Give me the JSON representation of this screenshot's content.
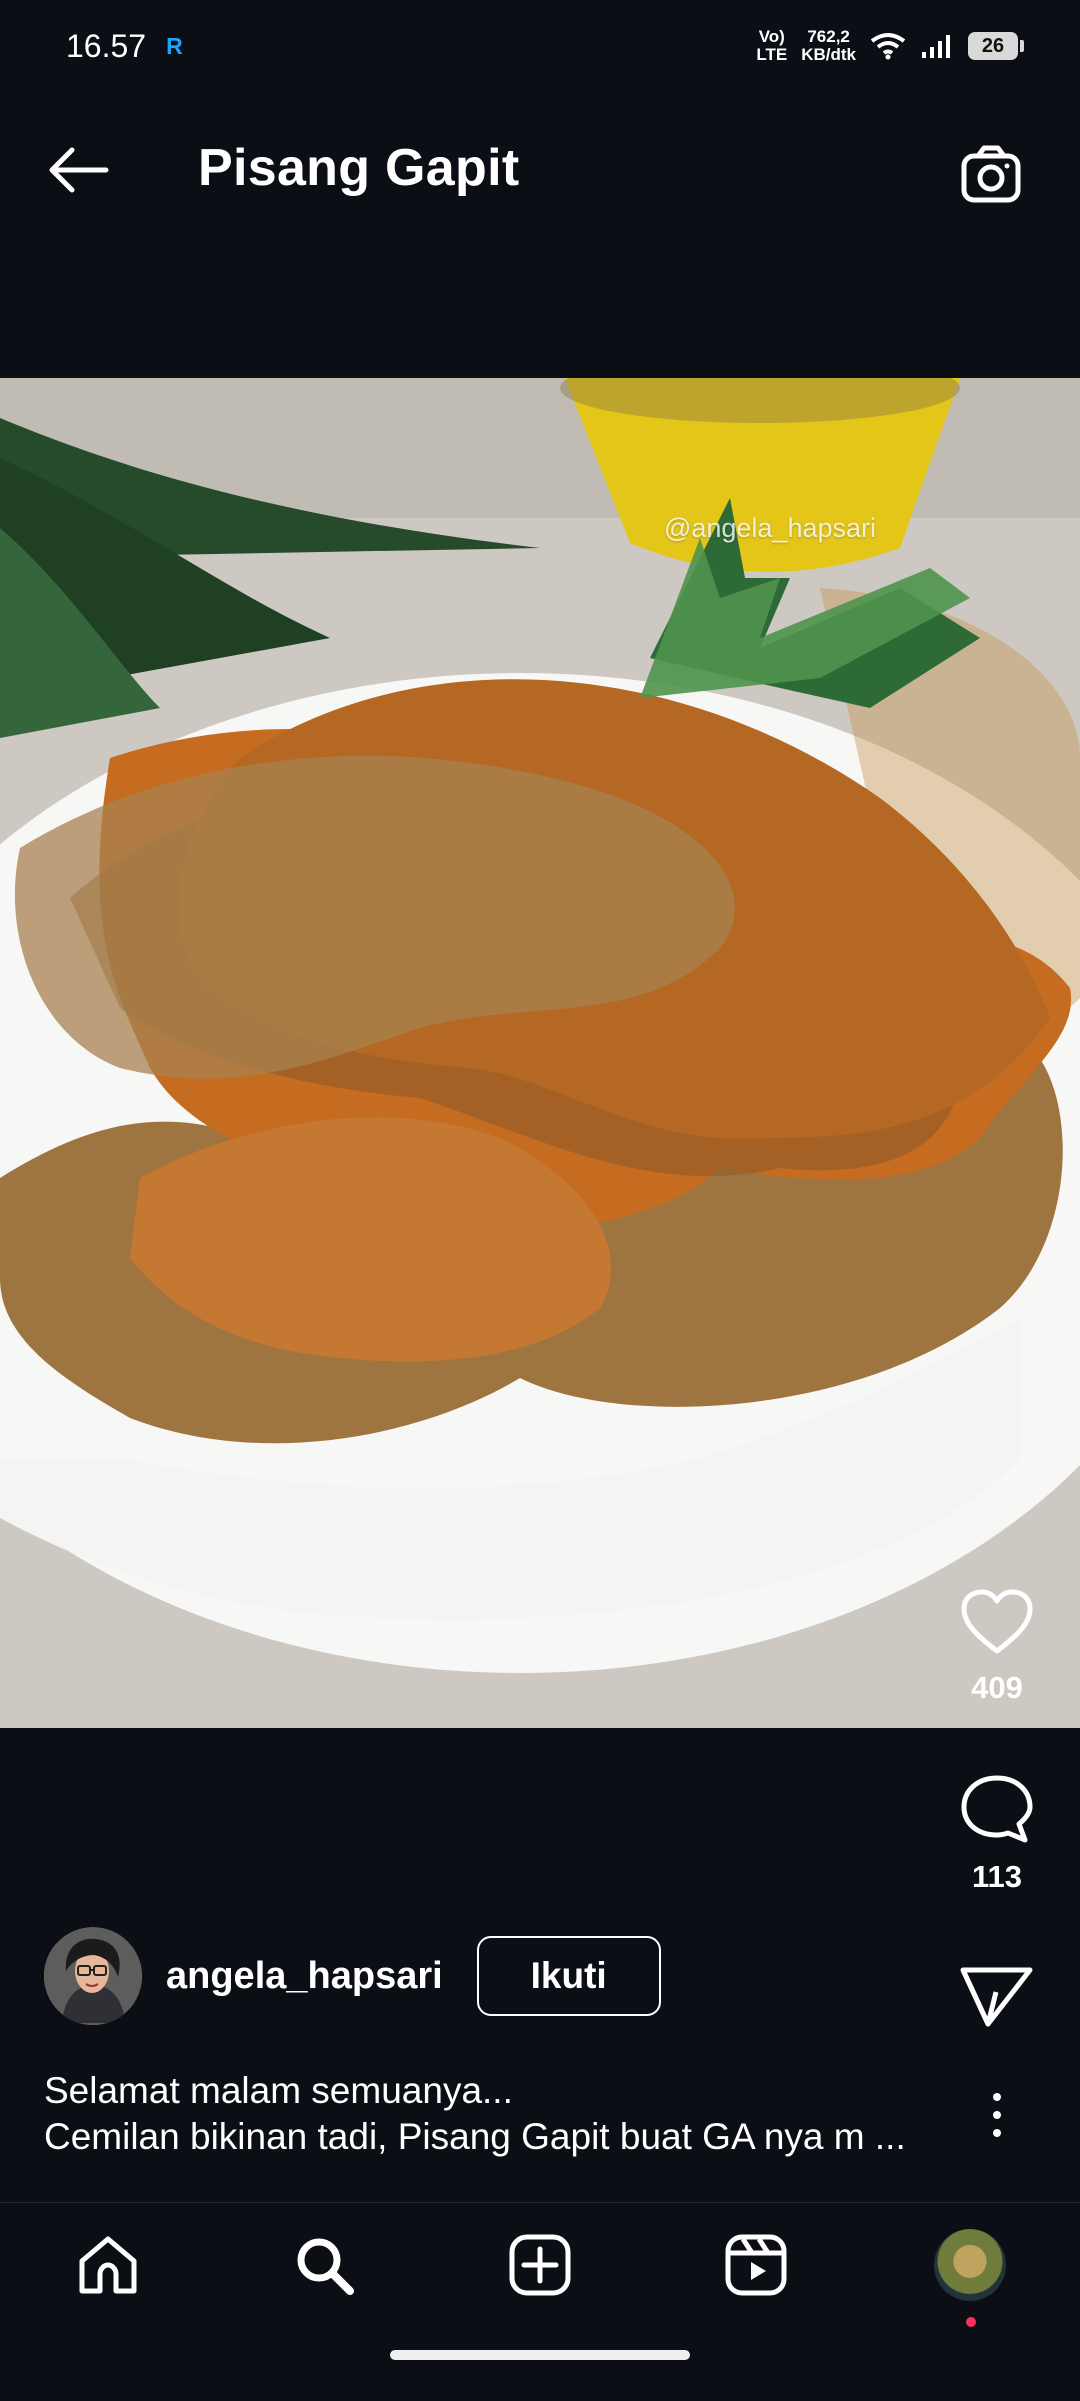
{
  "status": {
    "time": "16.57",
    "net_left": "Vo)",
    "net_left2": "LTE",
    "speed1": "762,2",
    "speed2": "KB/dtk",
    "battery": "26"
  },
  "header": {
    "title": "Pisang Gapit"
  },
  "photo": {
    "watermark": "@angela_hapsari"
  },
  "actions": {
    "likes": "409",
    "comments": "113"
  },
  "post": {
    "username": "angela_hapsari",
    "follow_label": "Ikuti",
    "caption_line1": "Selamat malam semuanya...",
    "caption_line2": "Cemilan bikinan tadi, Pisang Gapit buat GA nya m ..."
  }
}
